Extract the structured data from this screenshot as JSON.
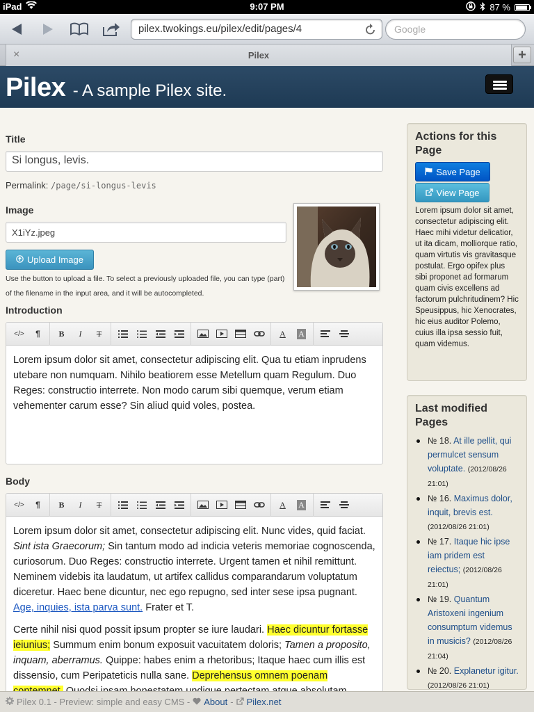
{
  "status_bar": {
    "device": "iPad",
    "time": "9:07 PM",
    "battery": "87 %"
  },
  "browser": {
    "url": "pilex.twokings.eu/pilex/edit/pages/4",
    "search_placeholder": "Google",
    "tab_title": "Pilex",
    "tab_close": "×",
    "tab_add": "+"
  },
  "site": {
    "name": "Pilex",
    "tagline": "- A sample Pilex site."
  },
  "form": {
    "title_label": "Title",
    "title_value": "Si longus, levis.",
    "permalink_label": "Permalink:",
    "permalink_value": "/page/si-longus-levis",
    "image_label": "Image",
    "image_value": "X1iYz.jpeg",
    "upload_label": "Upload Image",
    "upload_help": "Use the button to upload a file. To select a previously uploaded file, you can type (part) of the filename in the input area, and it will be autocompleted.",
    "intro_label": "Introduction",
    "intro_text": "Lorem ipsum dolor sit amet, consectetur adipiscing elit. Qua tu etiam inprudens utebare non numquam. Nihilo beatiorem esse Metellum quam Regulum. Duo Reges: constructio interrete. Non modo carum sibi quemque, verum etiam vehementer carum esse? Sin aliud quid voles, postea.",
    "body_label": "Body",
    "body_p1_a": "Lorem ipsum dolor sit amet, consectetur adipiscing elit. Nunc vides, quid faciat. ",
    "body_p1_em": "Sint ista Graecorum;",
    "body_p1_b": " Sin tantum modo ad indicia veteris memoriae cognoscenda, curiosorum. Duo Reges: constructio interrete. Urgent tamen et nihil remittunt. Neminem videbis ita laudatum, ut artifex callidus comparandarum voluptatum diceretur. Haec bene dicuntur, nec ego repugno, sed inter sese ipsa pugnant. ",
    "body_p1_link": "Age, inquies, ista parva sunt.",
    "body_p1_c": " Frater et T.",
    "body_p2_a": "Certe nihil nisi quod possit ipsum propter se iure laudari. ",
    "body_p2_hl1": "Haec dicuntur fortasse ieiunius;",
    "body_p2_b": " Summum enim bonum exposuit vacuitatem doloris; ",
    "body_p2_em": "Tamen a proposito, inquam, aberramus.",
    "body_p2_c": " Quippe: habes enim a rhetoribus; Itaque haec cum illis est dissensio, cum Peripateticis nulla sane. ",
    "body_p2_hl2": "Deprehensus omnem poenam contemnet.",
    "body_p2_d": " Quodsi ipsam honestatem undique pertectam atque absolutam."
  },
  "editor_toolbar": {
    "html": "</>",
    "format": "¶",
    "bold": "B",
    "italic": "I",
    "strike": "T",
    "fontcolor": "A",
    "backcolor": "A"
  },
  "sidebar": {
    "actions_title": "Actions for this Page",
    "save_label": "Save Page",
    "view_label": "View Page",
    "actions_text": "Lorem ipsum dolor sit amet, consectetur adipiscing elit. Haec mihi videtur delicatior, ut ita dicam, molliorque ratio, quam virtutis vis gravitasque postulat. Ergo opifex plus sibi proponet ad formarum quam civis excellens ad factorum pulchritudinem? Hic Speusippus, hic Xenocrates, hic eius auditor Polemo, cuius illa ipsa sessio fuit, quam videmus.",
    "recent_title": "Last modified Pages",
    "recent": [
      {
        "num": "№ 18.",
        "title": "At ille pellit, qui permulcet sensum voluptate.",
        "date": "(2012/08/26 21:01)"
      },
      {
        "num": "№ 16.",
        "title": "Maximus dolor, inquit, brevis est.",
        "date": "(2012/08/26 21:01)"
      },
      {
        "num": "№ 17.",
        "title": "Itaque hic ipse iam pridem est reiectus;",
        "date": "(2012/08/26 21:01)"
      },
      {
        "num": "№ 19.",
        "title": "Quantum Aristoxeni ingenium consumptum videmus in musicis?",
        "date": "(2012/08/26 21:04)"
      },
      {
        "num": "№ 20.",
        "title": "Explanetur igitur.",
        "date": "(2012/08/26 21:01)"
      }
    ]
  },
  "footer": {
    "version": "Pilex 0.1 - Preview: simple and easy CMS -",
    "about": "About",
    "sep": "-",
    "site_link": "Pilex.net"
  }
}
